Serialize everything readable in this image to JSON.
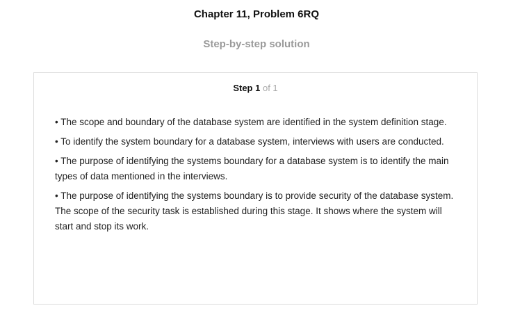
{
  "header": {
    "title": "Chapter 11, Problem 6RQ",
    "subtitle": "Step-by-step solution"
  },
  "step": {
    "label": "Step 1",
    "count": "of 1",
    "items": [
      "• The scope and boundary of the database system are identified in the system definition stage.",
      "• To identify the system boundary for a database system, interviews with users are conducted.",
      "• The purpose of identifying the systems boundary for a database system is to identify the main types of data mentioned in the interviews.",
      "• The purpose of identifying the systems boundary is to provide security of the database system. The scope of the security task is established during this stage. It shows where the system will start and stop its work."
    ]
  }
}
